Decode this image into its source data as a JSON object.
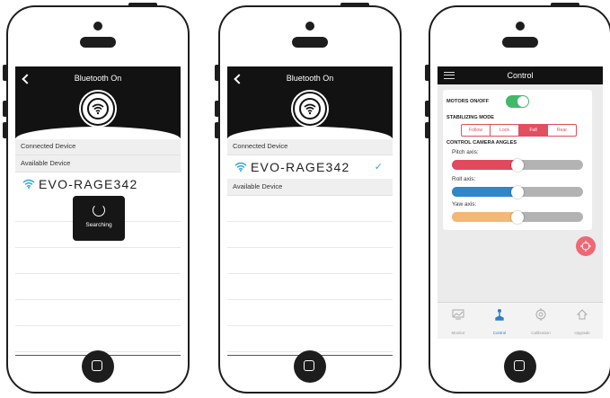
{
  "screen1": {
    "title": "Bluetooth On",
    "connected_header": "Connected Device",
    "available_header": "Available Device",
    "device_name": "EVO-RAGE342",
    "searching_label": "Searching"
  },
  "screen2": {
    "title": "Bluetooth On",
    "connected_header": "Connected Device",
    "device_name": "EVO-RAGE342",
    "check_mark": "✓",
    "available_header": "Available Device"
  },
  "screen3": {
    "title": "Control",
    "motors_label": "MOTORS ON/OFF",
    "motors_on": true,
    "stabilizing_label": "STABILIZING MODE",
    "modes": [
      "Follow",
      "Lock",
      "Full",
      "Rear"
    ],
    "selected_mode": "Full",
    "angles_label": "CONTROL CAMERA ANGLES",
    "axes": [
      {
        "label": "Pitch axis:",
        "value": 0.5,
        "color": "#e14a5d"
      },
      {
        "label": "Roll axis:",
        "value": 0.5,
        "color": "#2f86c8"
      },
      {
        "label": "Yaw axis:",
        "value": 0.5,
        "color": "#f3b877"
      }
    ],
    "tabs": [
      "Monitor",
      "Control",
      "Calibration",
      "Upgrade"
    ],
    "active_tab": "Control"
  },
  "colors": {
    "accent": "#e24f5e",
    "toggle_on": "#42b96a",
    "check": "#2aa8e0",
    "header": "#121212"
  }
}
